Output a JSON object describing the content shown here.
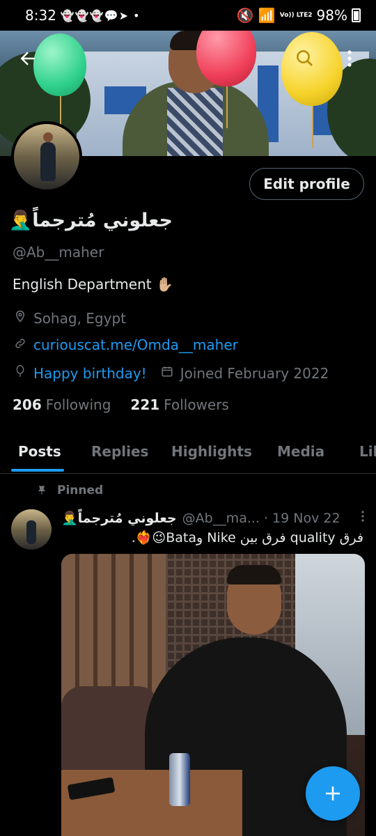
{
  "status_bar": {
    "time": "8:32",
    "notification_icons": "👻👻👻💬➤ •",
    "signal_label": "Vo)) LTE2",
    "battery": "98%"
  },
  "header": {
    "back_icon": "arrow-left",
    "search_icon": "magnifier",
    "more_icon": "vertical-ellipsis"
  },
  "profile": {
    "edit_button": "Edit profile",
    "display_name": "جعلوني مُترجماً🤦‍♂️",
    "handle": "@Ab__maher",
    "bio": "English Department ✋🏼",
    "location": "Sohag, Egypt",
    "website": "curiouscat.me/Omda__maher",
    "birthday": "Happy birthday!",
    "joined": "Joined February 2022",
    "following_count": "206",
    "following_label": "Following",
    "followers_count": "221",
    "followers_label": "Followers"
  },
  "tabs": [
    {
      "label": "Posts",
      "active": true
    },
    {
      "label": "Replies",
      "active": false
    },
    {
      "label": "Highlights",
      "active": false
    },
    {
      "label": "Media",
      "active": false
    },
    {
      "label": "Lik",
      "active": false
    }
  ],
  "pinned_tweet": {
    "pinned_label": "Pinned",
    "author_name": "جعلوني مُترجماً🤦‍♂️",
    "author_handle": "@Ab__ma...",
    "date": "· 19 Nov 22",
    "text": "فرق quality فرق بين Nike وBata😉❤️‍🔥."
  },
  "fab": {
    "icon": "plus"
  },
  "colors": {
    "accent": "#1d9bf0",
    "background": "#000000",
    "muted": "#71767b"
  }
}
